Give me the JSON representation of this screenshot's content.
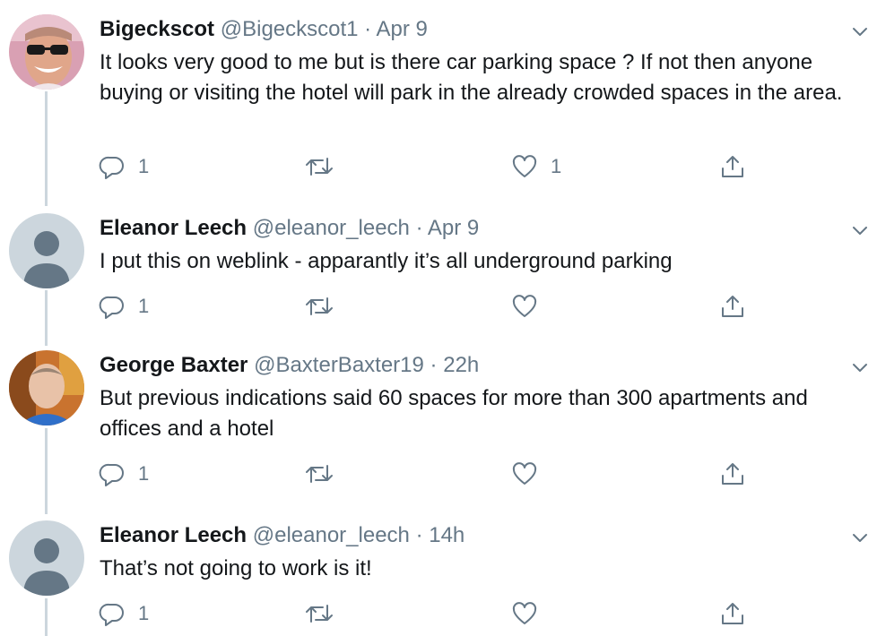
{
  "tweets": [
    {
      "name": "Bigeckscot",
      "handle": "@Bigeckscot1",
      "time": "Apr 9",
      "text": "It looks very good to me but is there car parking space ?  If not then anyone buying or visiting the hotel will park in the already crowded spaces in the area.",
      "avatar": "photo",
      "replies": "1",
      "retweets": "",
      "likes": "1"
    },
    {
      "name": "Eleanor Leech",
      "handle": "@eleanor_leech",
      "time": "Apr 9",
      "text": "I put this on weblink - apparantly it’s all underground parking",
      "avatar": "default",
      "replies": "1",
      "retweets": "",
      "likes": ""
    },
    {
      "name": "George Baxter",
      "handle": "@BaxterBaxter19",
      "time": "22h",
      "text": "But previous indications said 60 spaces for more than 300 apartments and offices and a hotel",
      "avatar": "photo",
      "replies": "1",
      "retweets": "",
      "likes": ""
    },
    {
      "name": "Eleanor Leech",
      "handle": "@eleanor_leech",
      "time": "14h",
      "text": "That’s not going to work is it!",
      "avatar": "default",
      "replies": "1",
      "retweets": "",
      "likes": ""
    }
  ],
  "icons": {
    "reply": "reply-icon",
    "retweet": "retweet-icon",
    "like": "heart-icon",
    "share": "share-icon",
    "menu": "chevron-down-icon"
  },
  "colors": {
    "text": "#14171a",
    "secondary": "#657786",
    "thread_line": "#ccd6dd",
    "default_avatar_bg": "#ccd6dd",
    "default_avatar_fg": "#657786"
  }
}
